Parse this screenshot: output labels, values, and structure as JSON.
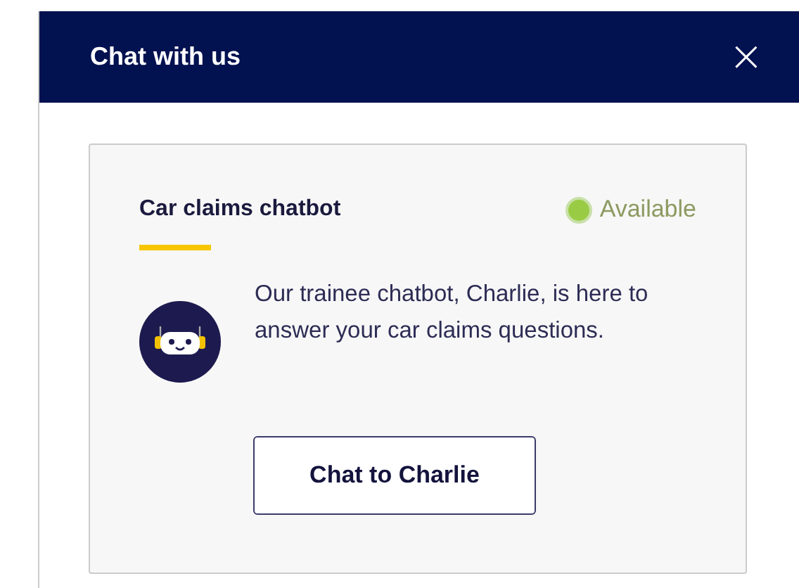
{
  "window": {
    "title": "Chat with us",
    "close": "×"
  },
  "card": {
    "title": "Car claims chatbot",
    "status": {
      "label": "Available",
      "available": true
    },
    "description": "Our trainee chatbot, Charlie, is here to answer your car claims questions.",
    "button": "Chat to Charlie"
  }
}
